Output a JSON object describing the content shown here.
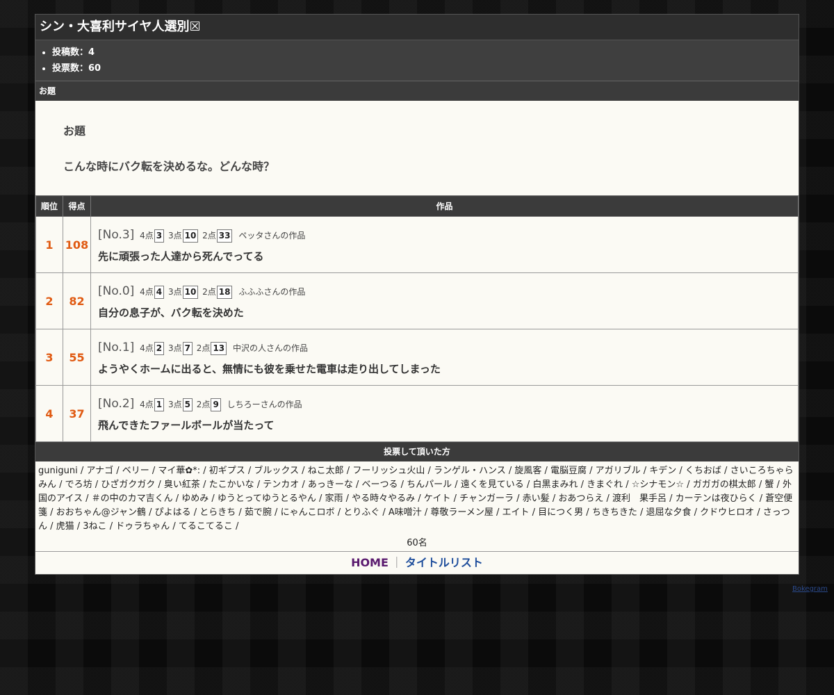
{
  "page_title": "シン・大喜利サイヤ人選別☒",
  "stats": {
    "posts_label": "投稿数：4",
    "votes_label": "投票数：60"
  },
  "topic_section_label": "お題",
  "topic": {
    "heading": "お題",
    "text": "こんな時にバク転を決めるな。どんな時？"
  },
  "results_table": {
    "headers": {
      "rank": "順位",
      "score": "得点",
      "work": "作品"
    },
    "rows": [
      {
        "rank": "1",
        "score": "108",
        "no": "[No.3]",
        "p4_label": "4点",
        "p4": "3",
        "p3_label": "3点",
        "p3": "10",
        "p2_label": "2点",
        "p2": "33",
        "author": "ペッタさんの作品",
        "text": "先に頑張った人達から死んでってる"
      },
      {
        "rank": "2",
        "score": "82",
        "no": "[No.0]",
        "p4_label": "4点",
        "p4": "4",
        "p3_label": "3点",
        "p3": "10",
        "p2_label": "2点",
        "p2": "18",
        "author": "ふふふさんの作品",
        "text": "自分の息子が、バク転を決めた"
      },
      {
        "rank": "3",
        "score": "55",
        "no": "[No.1]",
        "p4_label": "4点",
        "p4": "2",
        "p3_label": "3点",
        "p3": "7",
        "p2_label": "2点",
        "p2": "13",
        "author": "中沢の人さんの作品",
        "text": "ようやくホームに出ると、無情にも彼を乗せた電車は走り出してしまった"
      },
      {
        "rank": "4",
        "score": "37",
        "no": "[No.2]",
        "p4_label": "4点",
        "p4": "1",
        "p3_label": "3点",
        "p3": "5",
        "p2_label": "2点",
        "p2": "9",
        "author": "しちろーさんの作品",
        "text": "飛んできたファールボールが当たって"
      }
    ]
  },
  "voters_section_label": "投票して頂いた方",
  "voters_text": "guniguni / アナゴ / ベリー / マイ華✿*: / 初ギプス / ブルックス / ねこ太郎 / フーリッシュ火山 / ランゲル・ハンス / 旋風客 / 電脳豆腐 / アガリブル / キデン / くちおば / さいころちゃらみん / でろ坊 / ひざガクガク / 臭い紅茶 / たこかいな / テンカオ / あっきーな / ベーつる / ちんパール / 遠くを見ている / 白黒まみれ / きまぐれ / ☆シナモン☆ / ガガガの棋太郎 / 蟹 / 外国のアイス / ＃の中のカマ吉くん / ゆめみ / ゆうとってゆうとるやん / 家雨 / やる時々やるみ / ケイト / チャンガーラ / 赤い髪 / おあつらえ / 渡利　果手呂 / カーテンは夜ひらく / 蒼空便箋 / おおちゃん@ジャン鶴 / ぴよはる / とらきち / 茹で腕 / にゃんこロボ / とりふぐ / A味噌汁 / 尊敬ラーメン屋 / エイト / 目につく男 / ちきちきた / 退屈な夕食 / クドウヒロオ / さっつん / 虎猫 / 3ねこ / ドゥラちゃん / てるこてるこ /",
  "voters_count": "60名",
  "footer": {
    "home_label": "HOME",
    "separator": "｜",
    "title_list_label": "タイトルリスト"
  },
  "brand_label": "Bokegram"
}
